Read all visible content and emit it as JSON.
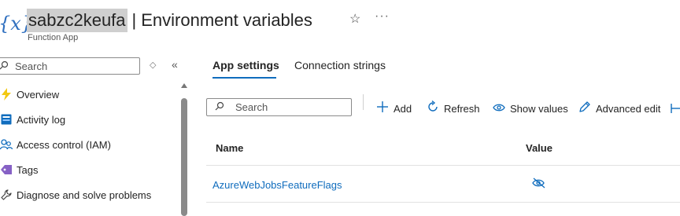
{
  "header": {
    "resource_name": "sabzc2keufa",
    "separator": "|",
    "page_title": "Environment variables",
    "subtitle": "Function App",
    "logo_text": "{x}",
    "favorite_glyph": "☆",
    "more_glyph": "···"
  },
  "sidebar": {
    "search_placeholder": "Search",
    "items": [
      {
        "label": "Overview",
        "icon": "lightning-icon",
        "color": "#f2c811"
      },
      {
        "label": "Activity log",
        "icon": "activity-log-icon",
        "color": "#0f6cbd"
      },
      {
        "label": "Access control (IAM)",
        "icon": "people-icon",
        "color": "#0f6cbd"
      },
      {
        "label": "Tags",
        "icon": "tag-icon",
        "color": "#8661c5"
      },
      {
        "label": "Diagnose and solve problems",
        "icon": "wrench-icon",
        "color": "#444444"
      }
    ]
  },
  "tabs": [
    {
      "label": "App settings",
      "active": true
    },
    {
      "label": "Connection strings",
      "active": false
    }
  ],
  "toolbar": {
    "search_placeholder": "Search",
    "add_label": "Add",
    "refresh_label": "Refresh",
    "show_values_label": "Show values",
    "advanced_edit_label": "Advanced edit"
  },
  "table": {
    "columns": [
      "Name",
      "Value"
    ],
    "rows": [
      {
        "name": "AzureWebJobsFeatureFlags",
        "value_hidden": true
      }
    ]
  },
  "colors": {
    "accent": "#0f6cbd",
    "highlight": "#cfcfcf"
  }
}
